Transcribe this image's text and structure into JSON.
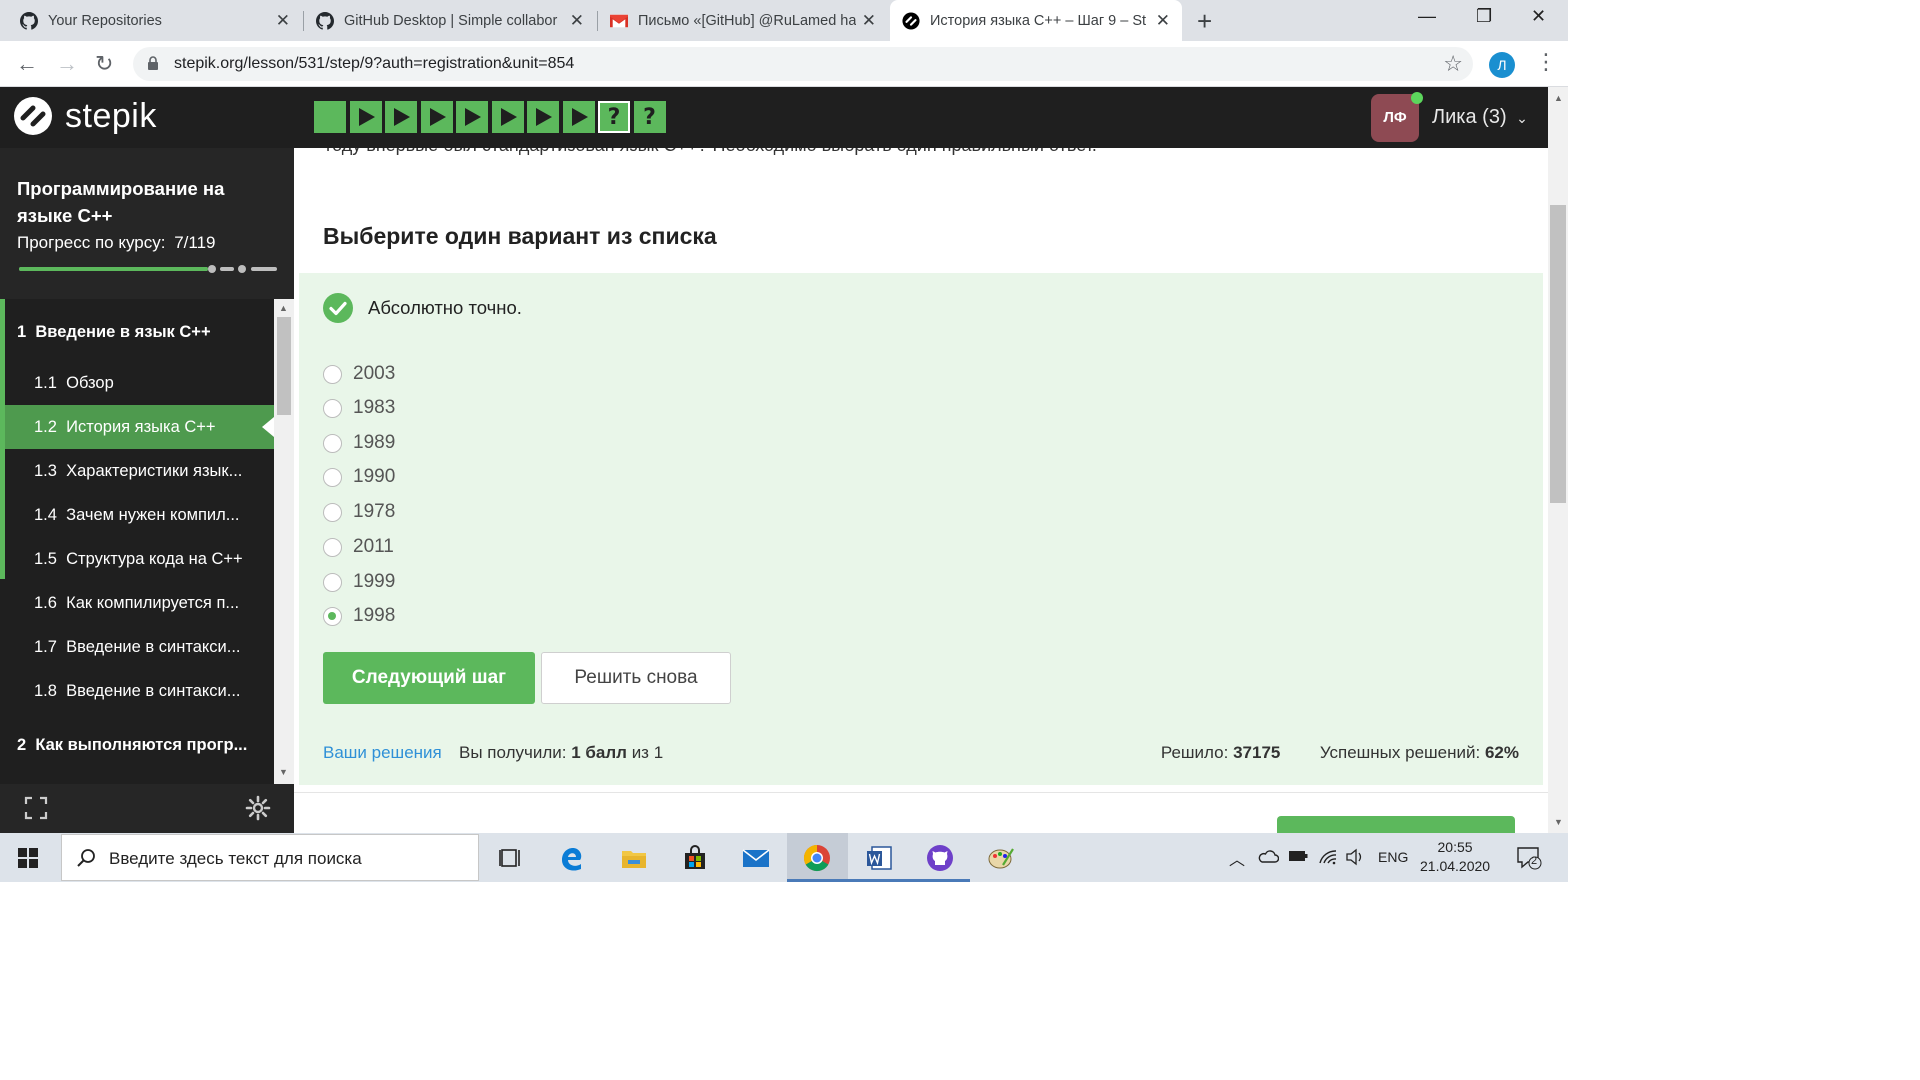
{
  "browser": {
    "tabs": [
      {
        "title": "Your Repositories",
        "icon": "github-icon"
      },
      {
        "title": "GitHub Desktop | Simple collabor",
        "icon": "github-icon"
      },
      {
        "title": "Письмо «[GitHub] @RuLamed ha",
        "icon": "gmail-icon"
      },
      {
        "title": "История языка C++ – Шаг 9 – St",
        "icon": "stepik-icon",
        "active": true
      }
    ],
    "url": "stepik.org/lesson/531/step/9?auth=registration&unit=854",
    "profile_initial": "Л"
  },
  "header": {
    "logo_text": "stepik",
    "steps": [
      {
        "type": "text",
        "done": true
      },
      {
        "type": "video",
        "done": true
      },
      {
        "type": "video",
        "done": true
      },
      {
        "type": "video",
        "done": true
      },
      {
        "type": "video",
        "done": true
      },
      {
        "type": "video",
        "done": true
      },
      {
        "type": "video",
        "done": true
      },
      {
        "type": "video",
        "done": true
      },
      {
        "type": "quiz",
        "symbol": "?",
        "done": true,
        "current": true
      },
      {
        "type": "quiz",
        "symbol": "?",
        "done": true
      }
    ],
    "user_initials": "ЛФ",
    "user_name": "Лика (3)",
    "dropdown_glyph": "⌄"
  },
  "sidebar": {
    "course_title": "Программирование на языке C++",
    "progress_label": "Прогресс по курсу:",
    "progress_value": "7/119",
    "progress_fraction": 0.059,
    "sections": [
      {
        "number": "1",
        "title": "Введение в язык C++",
        "lessons": [
          {
            "number": "1.1",
            "title": "Обзор"
          },
          {
            "number": "1.2",
            "title": "История языка C++",
            "active": true
          },
          {
            "number": "1.3",
            "title": "Характеристики язык..."
          },
          {
            "number": "1.4",
            "title": "Зачем нужен компил..."
          },
          {
            "number": "1.5",
            "title": "Структура кода на C++"
          },
          {
            "number": "1.6",
            "title": "Как компилируется п..."
          },
          {
            "number": "1.7",
            "title": "Введение в синтакси..."
          },
          {
            "number": "1.8",
            "title": "Введение в синтакси..."
          }
        ]
      },
      {
        "number": "2",
        "title": "Как выполняются прогр..."
      }
    ]
  },
  "main": {
    "question_clipped": "году впервые был стандартизован язык C++? Необходимо выбрать один правильный ответ.",
    "heading": "Выберите один вариант из списка",
    "feedback": "Абсолютно точно.",
    "options": [
      {
        "label": "2003",
        "checked": false
      },
      {
        "label": "1983",
        "checked": false
      },
      {
        "label": "1989",
        "checked": false
      },
      {
        "label": "1990",
        "checked": false
      },
      {
        "label": "1978",
        "checked": false
      },
      {
        "label": "2011",
        "checked": false
      },
      {
        "label": "1999",
        "checked": false
      },
      {
        "label": "1998",
        "checked": true
      }
    ],
    "next_button": "Следующий шаг",
    "retry_button": "Решить снова",
    "solutions_link": "Ваши решения",
    "score_prefix": "Вы получили:",
    "score_value": "1 балл",
    "score_suffix": "из 1",
    "solved_label": "Решило:",
    "solved_value": "37175",
    "success_label": "Успешных решений:",
    "success_value": "62%"
  },
  "taskbar": {
    "search_placeholder": "Введите здесь текст для поиска",
    "language": "ENG",
    "time": "20:55",
    "date": "21.04.2020",
    "notification_count": "2"
  },
  "colors": {
    "stepik_green": "#5cb85c",
    "stepik_dark": "#1f1f1f",
    "quiz_bg": "#e9f6e9",
    "link_blue": "#2f90d7",
    "avatar": "#8e4a53"
  }
}
